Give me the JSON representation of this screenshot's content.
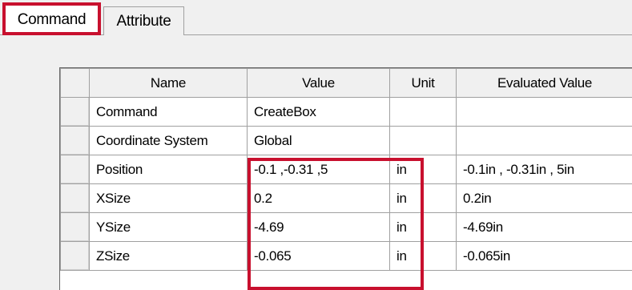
{
  "tabs": [
    {
      "label": "Command",
      "selected": true
    },
    {
      "label": "Attribute",
      "selected": false
    }
  ],
  "grid": {
    "columns": [
      "Name",
      "Value",
      "Unit",
      "Evaluated Value"
    ],
    "rows": [
      {
        "name": "Command",
        "value": "CreateBox",
        "unit": "",
        "evaluated": ""
      },
      {
        "name": "Coordinate System",
        "value": "Global",
        "unit": "",
        "evaluated": ""
      },
      {
        "name": "Position",
        "value": "-0.1 ,-0.31 ,5",
        "unit": "in",
        "evaluated": "-0.1in , -0.31in , 5in"
      },
      {
        "name": "XSize",
        "value": "0.2",
        "unit": "in",
        "evaluated": "0.2in"
      },
      {
        "name": "YSize",
        "value": "-4.69",
        "unit": "in",
        "evaluated": "-4.69in"
      },
      {
        "name": "ZSize",
        "value": "-0.065",
        "unit": "in",
        "evaluated": "-0.065in"
      }
    ]
  },
  "colors": {
    "highlight": "#c8102e",
    "panel": "#f0f0f0",
    "grid_line": "#a0a0a0"
  }
}
